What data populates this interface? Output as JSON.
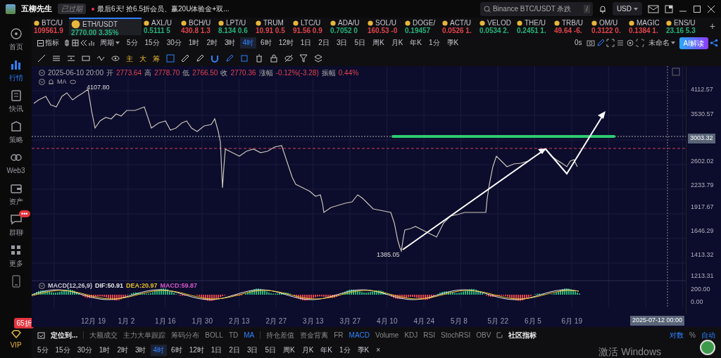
{
  "header": {
    "logo_text": "五柳先生",
    "status": "已过期",
    "promo": "最后6天! 抢6.5折会员、赢20U体验金+双...",
    "search_placeholder": "Binance BTC/USDT 杀跌",
    "search_key": "/",
    "currency": "USD"
  },
  "sidebar": {
    "items": [
      {
        "label": "首页",
        "selected": false
      },
      {
        "label": "行情",
        "selected": true
      },
      {
        "label": "快讯",
        "selected": false
      },
      {
        "label": "策略",
        "selected": false
      },
      {
        "label": "Web3",
        "selected": false
      },
      {
        "label": "资产",
        "selected": false
      },
      {
        "label": "群聊",
        "selected": false,
        "badge": "•••"
      },
      {
        "label": "更多",
        "selected": false
      }
    ],
    "vip": {
      "label": "VIP",
      "badge": "65折"
    }
  },
  "tickers": [
    {
      "symbol": "BTC/U",
      "price": "109561.9",
      "color": "#e0444a",
      "selected": false
    },
    {
      "symbol": "ETH/USDT",
      "price": "2770.00",
      "change": "3.35%",
      "color": "#26b27a",
      "selected": true
    },
    {
      "symbol": "AXL/U",
      "price": "0.5111",
      "change": "5",
      "color": "#26b27a",
      "selected": false
    },
    {
      "symbol": "BCH/U",
      "price": "430.8",
      "change": "1.3",
      "color": "#e0444a",
      "selected": false
    },
    {
      "symbol": "LPT/U",
      "price": "8.134",
      "change": "0.6",
      "color": "#26b27a",
      "selected": false
    },
    {
      "symbol": "TRUM",
      "price": "10.91",
      "change": "0.5",
      "color": "#e0444a",
      "selected": false
    },
    {
      "symbol": "LTC/U",
      "price": "91.56",
      "change": "0.9",
      "color": "#e0444a",
      "selected": false
    },
    {
      "symbol": "ADA/U",
      "price": "0.7052",
      "change": "0",
      "color": "#26b27a",
      "selected": false
    },
    {
      "symbol": "SOL/U",
      "price": "160.53",
      "change": "-0",
      "color": "#e0444a",
      "selected": false
    },
    {
      "symbol": "DOGE/",
      "price": "0.19457",
      "color": "#26b27a",
      "selected": false
    },
    {
      "symbol": "ACT/U",
      "price": "0.0526",
      "change": "1.",
      "color": "#e0444a",
      "selected": false
    },
    {
      "symbol": "VELOD",
      "price": "0.0534",
      "change": "2.",
      "color": "#26b27a",
      "selected": false
    },
    {
      "symbol": "THE/U",
      "price": "0.2451",
      "change": "1.",
      "color": "#26b27a",
      "selected": false
    },
    {
      "symbol": "TRB/U",
      "price": "49.64",
      "change": "-6.",
      "color": "#e0444a",
      "selected": false
    },
    {
      "symbol": "OM/U",
      "price": "0.3122",
      "change": "0.",
      "color": "#e0444a",
      "selected": false
    },
    {
      "symbol": "MAGIC",
      "price": "0.1384",
      "change": "1.",
      "color": "#e0444a",
      "selected": false
    },
    {
      "symbol": "ENS/U",
      "price": "23.16",
      "change": "5.3",
      "color": "#26b27a",
      "selected": false
    }
  ],
  "add_ticker": "+",
  "toolbar": {
    "indicator_label": "指标",
    "period_label": "周期",
    "timeframes": [
      {
        "label": "5分",
        "selected": false
      },
      {
        "label": "15分",
        "selected": false
      },
      {
        "label": "30分",
        "selected": false
      },
      {
        "label": "1时",
        "selected": false
      },
      {
        "label": "2时",
        "selected": false
      },
      {
        "label": "3时",
        "selected": false
      },
      {
        "label": "4时",
        "selected": true
      },
      {
        "label": "6时",
        "selected": false
      },
      {
        "label": "12时",
        "selected": false
      },
      {
        "label": "1日",
        "selected": false
      },
      {
        "label": "2日",
        "selected": false
      },
      {
        "label": "3日",
        "selected": false
      },
      {
        "label": "5日",
        "selected": false
      },
      {
        "label": "周K",
        "selected": false
      },
      {
        "label": "月K",
        "selected": false
      },
      {
        "label": "年K",
        "selected": false
      },
      {
        "label": "1分",
        "selected": false
      },
      {
        "label": "季K",
        "selected": false
      }
    ],
    "countdown": "0s",
    "layout_name": "未命名",
    "ai_button": "AI解读"
  },
  "drawing_tools": {
    "texts": [
      "主",
      "大",
      "筹"
    ]
  },
  "chart": {
    "info": [
      {
        "label": "2025-06-10 20:00"
      },
      {
        "label": "开",
        "value": "2773.64"
      },
      {
        "label": "高",
        "value": "2778.70"
      },
      {
        "label": "低",
        "value": "2766.50"
      },
      {
        "label": "收",
        "value": "2770.36"
      },
      {
        "label": "涨幅",
        "value": "-0.12%(-3.28)"
      },
      {
        "label": "振幅",
        "value": "0.44%"
      }
    ],
    "ma_label": "MA",
    "high_label": "4107.80",
    "low_label": "1385.05",
    "price_axis": [
      "4112.57",
      "3530.57",
      "2602.02",
      "2233.79",
      "1917.67",
      "1646.29",
      "1413.32",
      "1213.31",
      "200.00",
      "0.00"
    ],
    "crosshair_price": "3003.32",
    "macd": [
      {
        "text": "MACD(12,26,9)",
        "color": "#c8c8d0"
      },
      {
        "text": "DIF:50.91",
        "color": "#e8e8e8"
      },
      {
        "text": "DEA:20.97",
        "color": "#e6c229"
      },
      {
        "text": "MACD:59.87",
        "color": "#d657c8"
      }
    ],
    "date_axis": [
      "12月 19",
      "1月 2",
      "1月 16",
      "1月 30",
      "2月 13",
      "2月 27",
      "3月 13",
      "3月 27",
      "4月 10",
      "4月 24",
      "5月 8",
      "5月 22",
      "6月 5",
      "6月 19"
    ],
    "crosshair_date": "2025-07-12 00:00"
  },
  "indicator_bar": {
    "locate": "定位到...",
    "groups": [
      [
        {
          "label": "大额成交",
          "selected": false
        },
        {
          "label": "主力大单跟踪",
          "selected": false
        },
        {
          "label": "筹码分布",
          "selected": false
        },
        {
          "label": "BOLL",
          "selected": false
        },
        {
          "label": "TD",
          "selected": false
        },
        {
          "label": "MA",
          "selected": true
        }
      ],
      [
        {
          "label": "持仓差值",
          "selected": false
        },
        {
          "label": "资金背离",
          "selected": false
        },
        {
          "label": "FR",
          "selected": false
        },
        {
          "label": "MACD",
          "selected": true
        },
        {
          "label": "Volume",
          "selected": false
        },
        {
          "label": "KDJ",
          "selected": false
        },
        {
          "label": "RSI",
          "selected": false
        },
        {
          "label": "StochRSI",
          "selected": false
        },
        {
          "label": "OBV",
          "selected": false
        }
      ]
    ],
    "community": "社区指标",
    "scale_options": [
      {
        "label": "对数",
        "selected": true
      },
      {
        "label": "%",
        "selected": false
      },
      {
        "label": "自动",
        "selected": true
      }
    ]
  },
  "bottom_timeframes": [
    {
      "label": "5分",
      "selected": false
    },
    {
      "label": "15分",
      "selected": false
    },
    {
      "label": "30分",
      "selected": false
    },
    {
      "label": "1时",
      "selected": false
    },
    {
      "label": "2时",
      "selected": false
    },
    {
      "label": "3时",
      "selected": false
    },
    {
      "label": "4时",
      "selected": true
    },
    {
      "label": "6时",
      "selected": false
    },
    {
      "label": "12时",
      "selected": false
    },
    {
      "label": "1日",
      "selected": false
    },
    {
      "label": "2日",
      "selected": false
    },
    {
      "label": "3日",
      "selected": false
    },
    {
      "label": "5日",
      "selected": false
    },
    {
      "label": "周K",
      "selected": false
    },
    {
      "label": "月K",
      "selected": false
    },
    {
      "label": "年K",
      "selected": false
    },
    {
      "label": "1分",
      "selected": false
    },
    {
      "label": "季K",
      "selected": false
    }
  ],
  "bottom_close": "×",
  "os_notice": "激活 Windows"
}
